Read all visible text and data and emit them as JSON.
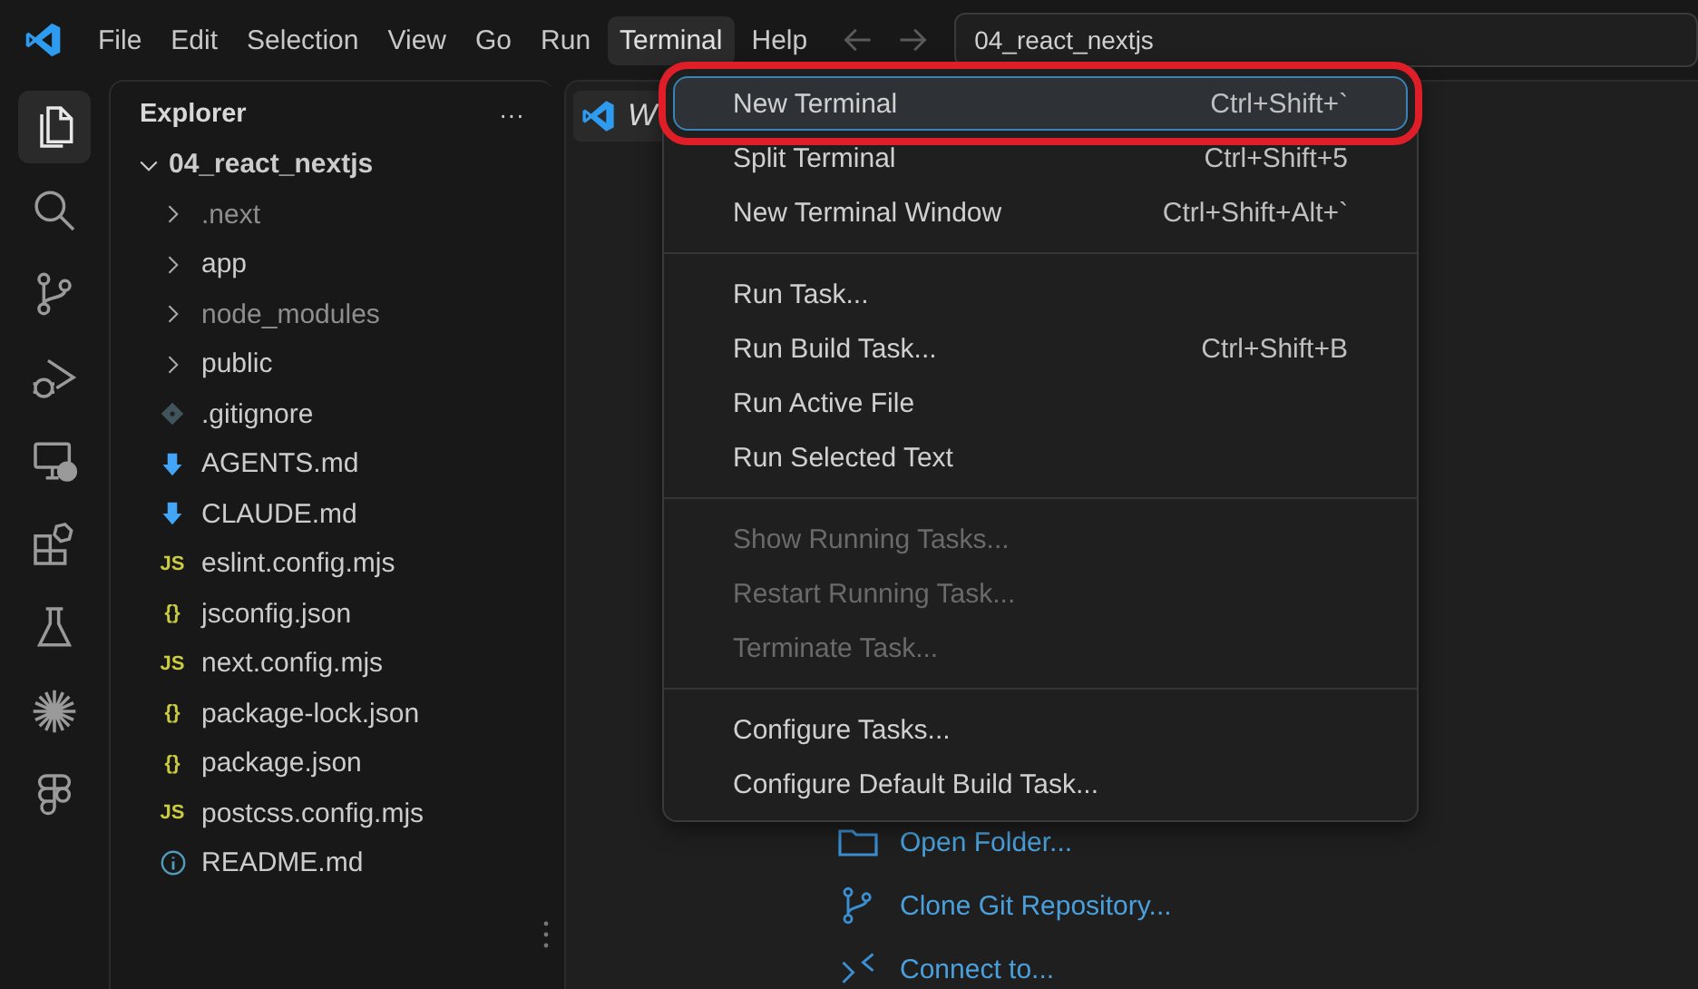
{
  "menubar": [
    {
      "label": "File",
      "selected": false
    },
    {
      "label": "Edit",
      "selected": false
    },
    {
      "label": "Selection",
      "selected": false
    },
    {
      "label": "View",
      "selected": false
    },
    {
      "label": "Go",
      "selected": false
    },
    {
      "label": "Run",
      "selected": false
    },
    {
      "label": "Terminal",
      "selected": true
    },
    {
      "label": "Help",
      "selected": false
    }
  ],
  "search": {
    "value": "04_react_nextjs"
  },
  "activity_bar": [
    {
      "kind": "files",
      "selected": true
    },
    {
      "kind": "search",
      "selected": false
    },
    {
      "kind": "source-control",
      "selected": false
    },
    {
      "kind": "debug",
      "selected": false
    },
    {
      "kind": "remote",
      "selected": false
    },
    {
      "kind": "extensions",
      "selected": false
    },
    {
      "kind": "testing",
      "selected": false
    },
    {
      "kind": "sparkle",
      "selected": false
    },
    {
      "kind": "figma",
      "selected": false
    }
  ],
  "explorer": {
    "title": "Explorer",
    "more": "···",
    "root": {
      "label": "04_react_nextjs",
      "expanded": true,
      "children": [
        {
          "label": ".next",
          "kind": "folder",
          "expanded": false,
          "dimmed": true
        },
        {
          "label": "app",
          "kind": "folder",
          "expanded": false,
          "dimmed": false
        },
        {
          "label": "node_modules",
          "kind": "folder",
          "expanded": false,
          "dimmed": true
        },
        {
          "label": "public",
          "kind": "folder",
          "expanded": false,
          "dimmed": false
        },
        {
          "label": ".gitignore",
          "kind": "git",
          "dimmed": false
        },
        {
          "label": "AGENTS.md",
          "kind": "md",
          "dimmed": false
        },
        {
          "label": "CLAUDE.md",
          "kind": "md",
          "dimmed": false
        },
        {
          "label": "eslint.config.mjs",
          "kind": "js",
          "badge": "JS",
          "dimmed": false
        },
        {
          "label": "jsconfig.json",
          "kind": "json",
          "badge": "{}",
          "dimmed": false
        },
        {
          "label": "next.config.mjs",
          "kind": "js",
          "badge": "JS",
          "dimmed": false
        },
        {
          "label": "package-lock.json",
          "kind": "json",
          "badge": "{}",
          "dimmed": false
        },
        {
          "label": "package.json",
          "kind": "json",
          "badge": "{}",
          "dimmed": false
        },
        {
          "label": "postcss.config.mjs",
          "kind": "js",
          "badge": "JS",
          "dimmed": false
        },
        {
          "label": "README.md",
          "kind": "info",
          "dimmed": false
        }
      ]
    }
  },
  "editor_tab": {
    "label": "W"
  },
  "welcome_links": [
    {
      "label": "Open Folder...",
      "kind": "folder"
    },
    {
      "label": "Clone Git Repository...",
      "kind": "git"
    },
    {
      "label": "Connect to...",
      "kind": "remote"
    }
  ],
  "terminal_menu": [
    {
      "kind": "item",
      "label": "New Terminal",
      "shortcut": "Ctrl+Shift+`",
      "selected": true,
      "disabled": false,
      "highlighted": true
    },
    {
      "kind": "item",
      "label": "Split Terminal",
      "shortcut": "Ctrl+Shift+5",
      "selected": false,
      "disabled": false,
      "highlighted": false
    },
    {
      "kind": "item",
      "label": "New Terminal Window",
      "shortcut": "Ctrl+Shift+Alt+`",
      "selected": false,
      "disabled": false,
      "highlighted": false
    },
    {
      "kind": "separator"
    },
    {
      "kind": "item",
      "label": "Run Task...",
      "selected": false,
      "disabled": false,
      "highlighted": false
    },
    {
      "kind": "item",
      "label": "Run Build Task...",
      "shortcut": "Ctrl+Shift+B",
      "selected": false,
      "disabled": false,
      "highlighted": false
    },
    {
      "kind": "item",
      "label": "Run Active File",
      "selected": false,
      "disabled": false,
      "highlighted": false
    },
    {
      "kind": "item",
      "label": "Run Selected Text",
      "selected": false,
      "disabled": false,
      "highlighted": false
    },
    {
      "kind": "separator"
    },
    {
      "kind": "item",
      "label": "Show Running Tasks...",
      "selected": false,
      "disabled": true,
      "highlighted": false
    },
    {
      "kind": "item",
      "label": "Restart Running Task...",
      "selected": false,
      "disabled": true,
      "highlighted": false
    },
    {
      "kind": "item",
      "label": "Terminate Task...",
      "selected": false,
      "disabled": true,
      "highlighted": false
    },
    {
      "kind": "separator"
    },
    {
      "kind": "item",
      "label": "Configure Tasks...",
      "selected": false,
      "disabled": false,
      "highlighted": false
    },
    {
      "kind": "item",
      "label": "Configure Default Build Task...",
      "selected": false,
      "disabled": false,
      "highlighted": false
    }
  ]
}
